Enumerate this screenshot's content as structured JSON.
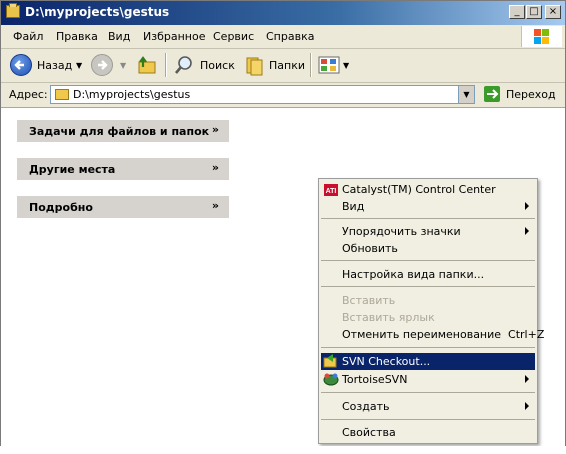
{
  "window": {
    "title": "D:\\myprojects\\gestus"
  },
  "title_buttons": {
    "minimize": "_",
    "maximize": "□",
    "close": "×"
  },
  "menu": [
    "Файл",
    "Правка",
    "Вид",
    "Избранное",
    "Сервис",
    "Справка"
  ],
  "toolbar": {
    "back_label": "Назад",
    "search_label": "Поиск",
    "folders_label": "Папки"
  },
  "address": {
    "label": "Адрес:",
    "value": "D:\\myprojects\\gestus",
    "go_label": "Переход"
  },
  "task_panels": [
    "Задачи для файлов и папок",
    "Другие места",
    "Подробно"
  ],
  "context_menu": {
    "items": [
      {
        "label": "Catalyst(TM) Control Center",
        "icon": "ati-icon"
      },
      {
        "label": "Вид",
        "submenu": true
      },
      {
        "label": "Упорядочить значки",
        "submenu": true
      },
      {
        "label": "Обновить"
      },
      {
        "label": "Настройка вида папки..."
      },
      {
        "label": "Вставить",
        "disabled": true
      },
      {
        "label": "Вставить ярлык",
        "disabled": true
      },
      {
        "label": "Отменить переименование  Ctrl+Z"
      },
      {
        "label": "SVN Checkout...",
        "highlighted": true,
        "icon": "svn-checkout-icon"
      },
      {
        "label": "TortoiseSVN",
        "submenu": true,
        "icon": "tortoisesvn-icon"
      },
      {
        "label": "Создать",
        "submenu": true
      },
      {
        "label": "Свойства"
      }
    ]
  },
  "colors": {
    "title_start": "#0a246a",
    "highlight": "#0a246a",
    "menu_bg": "#f1efe2",
    "panel_bg": "#d6d3ce"
  }
}
